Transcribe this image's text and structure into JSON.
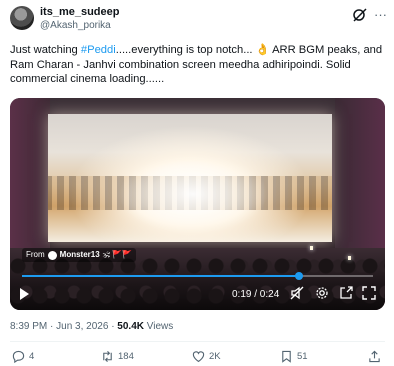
{
  "user": {
    "display_name": "its_me_sudeep",
    "handle": "@Akash_porika"
  },
  "tweet": {
    "text_before_tag": "Just watching ",
    "hashtag": "#Peddi",
    "text_after_tag": ".....everything is top notch... 👌 ARR BGM peaks, and Ram Charan - Janhvi combination screen meedha adhiripoindi. Solid commercial cinema loading......"
  },
  "video": {
    "watermark_prefix": "From",
    "watermark_brand": "Monster13",
    "watermark_emojis": "🕉 🚩🚩",
    "elapsed": "0:19",
    "duration": "0:24",
    "time_display": "0:19 / 0:24",
    "progress_fraction": 0.79
  },
  "meta": {
    "time": "8:39 PM",
    "date": "Jun 3, 2026",
    "views_count": "50.4K",
    "views_label": "Views"
  },
  "actions": {
    "replies": "4",
    "reposts": "184",
    "likes": "2K",
    "bookmarks": "51"
  },
  "icons": {
    "grok": "grok-icon",
    "more": "more-icon",
    "play": "play-icon",
    "mute": "muted-speaker-icon",
    "settings": "gear-icon",
    "pip": "picture-in-picture-icon",
    "fullscreen": "fullscreen-icon"
  },
  "colors": {
    "accent": "#1d9bf0",
    "text": "#0f1419",
    "secondary": "#536471"
  }
}
